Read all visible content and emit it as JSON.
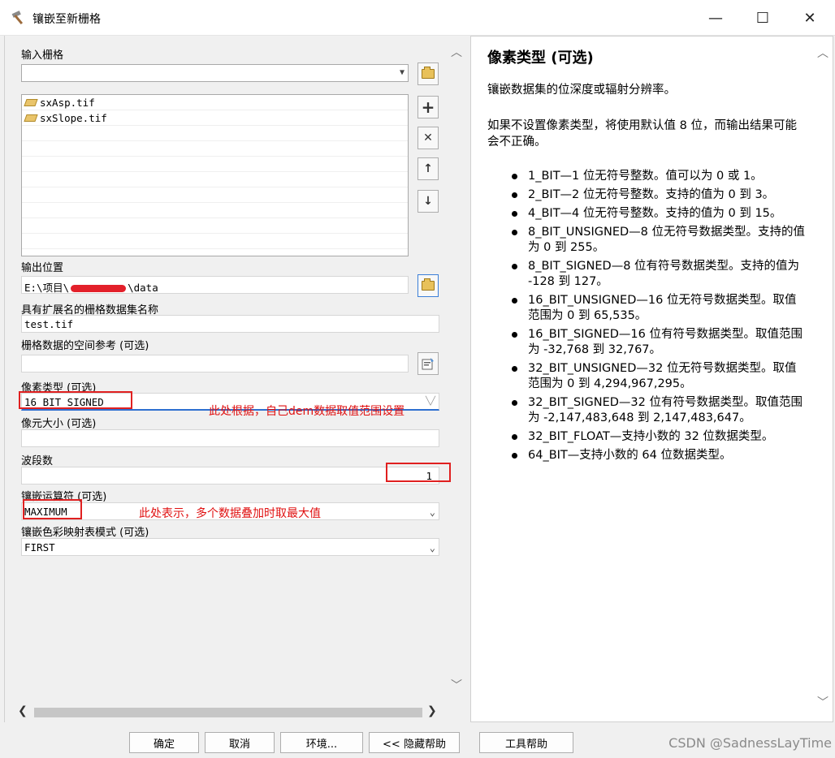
{
  "window": {
    "title": "镶嵌至新栅格",
    "minimize": "—",
    "maximize": "☐",
    "close": "✕"
  },
  "form": {
    "input_raster_label": "输入栅格",
    "input_raster_value": "",
    "input_files": [
      "sxAsp.tif",
      "sxSlope.tif"
    ],
    "output_location_label": "输出位置",
    "output_location_prefix": "E:\\项目\\",
    "output_location_suffix": "\\data",
    "dataset_name_label": "具有扩展名的栅格数据集名称",
    "dataset_name_value": "test.tif",
    "spatial_ref_label": "栅格数据的空间参考 (可选)",
    "spatial_ref_value": "",
    "pixel_type_label": "像素类型 (可选)",
    "pixel_type_value": "16_BIT_SIGNED",
    "cellsize_label": "像元大小 (可选)",
    "cellsize_value": "",
    "bands_label": "波段数",
    "bands_value": "1",
    "mosaic_operator_label": "镶嵌运算符 (可选)",
    "mosaic_operator_value": "MAXIMUM",
    "colormap_label": "镶嵌色彩映射表模式 (可选)",
    "colormap_value": "FIRST"
  },
  "annotations": {
    "pixel_type_note": "此处根据，自己dem数据取值范围设置",
    "operator_note": "此处表示，多个数据叠加时取最大值"
  },
  "side_buttons": {
    "add": "+",
    "remove": "✕",
    "up": "↑",
    "down": "↓"
  },
  "help": {
    "title": "像素类型 (可选)",
    "p1": "镶嵌数据集的位深度或辐射分辨率。",
    "p2": "如果不设置像素类型，将使用默认值 8 位，而输出结果可能会不正确。",
    "bullets": [
      "1_BIT—1 位无符号整数。值可以为 0 或 1。",
      "2_BIT—2 位无符号整数。支持的值为 0 到 3。",
      "4_BIT—4 位无符号整数。支持的值为 0 到 15。",
      "8_BIT_UNSIGNED—8 位无符号数据类型。支持的值为 0 到 255。",
      "8_BIT_SIGNED—8 位有符号数据类型。支持的值为 -128 到 127。",
      "16_BIT_UNSIGNED—16 位无符号数据类型。取值范围为 0 到 65,535。",
      "16_BIT_SIGNED—16 位有符号数据类型。取值范围为 -32,768 到 32,767。",
      "32_BIT_UNSIGNED—32 位无符号数据类型。取值范围为 0 到 4,294,967,295。",
      "32_BIT_SIGNED—32 位有符号数据类型。取值范围为 -2,147,483,648 到 2,147,483,647。",
      "32_BIT_FLOAT—支持小数的 32 位数据类型。",
      "64_BIT—支持小数的 64 位数据类型。"
    ]
  },
  "buttons": {
    "ok": "确定",
    "cancel": "取消",
    "env": "环境...",
    "hide_help": "<< 隐藏帮助",
    "tool_help": "工具帮助"
  },
  "watermark": "CSDN @SadnessLayTime"
}
